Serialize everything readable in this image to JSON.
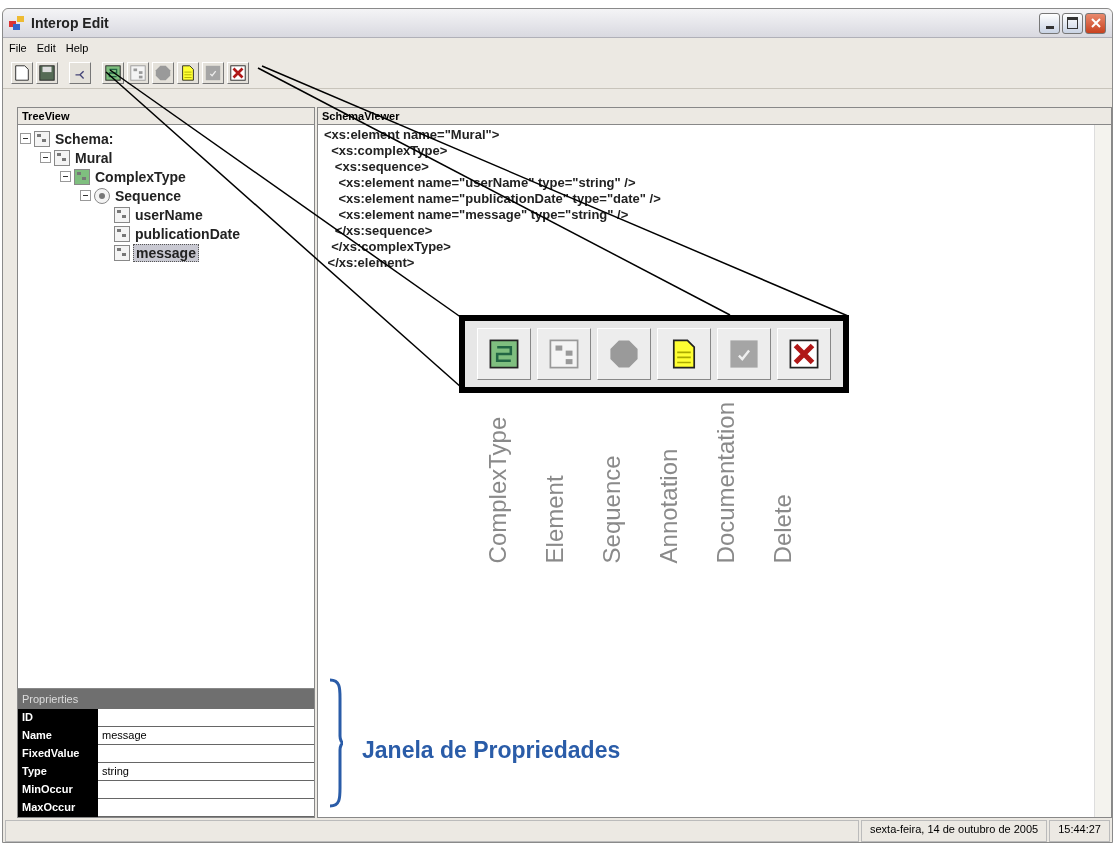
{
  "window": {
    "title": "Interop Edit"
  },
  "menu": [
    "File",
    "Edit",
    "Help"
  ],
  "toolbar": [
    {
      "kind": "new"
    },
    {
      "kind": "save"
    },
    {
      "kind": "generate"
    },
    {
      "kind": "complextype"
    },
    {
      "kind": "element"
    },
    {
      "kind": "sequence"
    },
    {
      "kind": "annotation"
    },
    {
      "kind": "documentation"
    },
    {
      "kind": "delete"
    }
  ],
  "tree": {
    "title": "TreeView",
    "nodes": [
      {
        "label": "Schema:",
        "kind": "element",
        "expanded": true,
        "selected": false,
        "children": [
          {
            "label": "Mural",
            "kind": "element",
            "expanded": true,
            "selected": false,
            "children": [
              {
                "label": "ComplexType",
                "kind": "complextype",
                "expanded": true,
                "selected": false,
                "children": [
                  {
                    "label": "Sequence",
                    "kind": "sequence",
                    "expanded": true,
                    "selected": false,
                    "children": [
                      {
                        "label": "userName",
                        "kind": "element",
                        "selected": false
                      },
                      {
                        "label": "publicationDate",
                        "kind": "element",
                        "selected": false
                      },
                      {
                        "label": "message",
                        "kind": "element",
                        "selected": true
                      }
                    ]
                  }
                ]
              }
            ]
          }
        ]
      }
    ]
  },
  "properties": {
    "title": "Proprierties",
    "rows": [
      {
        "name": "ID",
        "value": ""
      },
      {
        "name": "Name",
        "value": "message"
      },
      {
        "name": "FixedValue",
        "value": ""
      },
      {
        "name": "Type",
        "value": "string"
      },
      {
        "name": "MinOccur",
        "value": ""
      },
      {
        "name": "MaxOccur",
        "value": ""
      }
    ]
  },
  "schema_viewer": {
    "title": "SchemaViewer",
    "lines": [
      "<xs:element name=\"Mural\">",
      "  <xs:complexType>",
      "   <xs:sequence>",
      "    <xs:element name=\"userName\" type=\"string\" />",
      "    <xs:element name=\"publicationDate\" type=\"date\" />",
      "    <xs:element name=\"message\" type=\"string\" />",
      "   </xs:sequence>",
      "  </xs:complexType>",
      " </xs:element>"
    ]
  },
  "callout": {
    "buttons": [
      {
        "kind": "complextype",
        "label": "ComplexType"
      },
      {
        "kind": "element",
        "label": "Element"
      },
      {
        "kind": "sequence",
        "label": "Sequence"
      },
      {
        "kind": "annotation",
        "label": "Annotation"
      },
      {
        "kind": "documentation",
        "label": "Documentation"
      },
      {
        "kind": "delete",
        "label": "Delete"
      }
    ]
  },
  "properties_note": "Janela de Propriedades",
  "status_bar": {
    "date": "sexta-feira, 14 de outubro de 2005",
    "time": "15:44:27"
  }
}
